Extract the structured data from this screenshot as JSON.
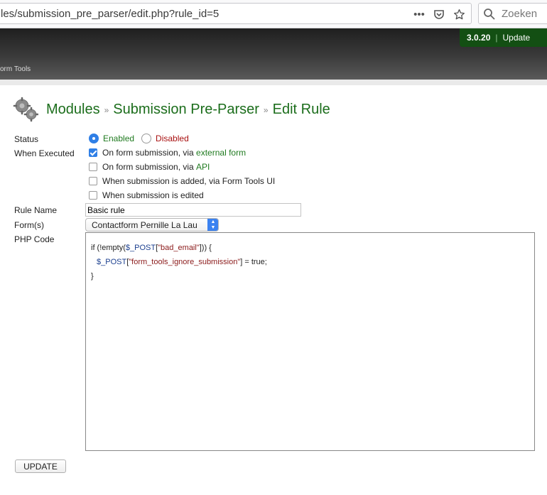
{
  "browser": {
    "url": "les/submission_pre_parser/edit.php?rule_id=5",
    "search_placeholder": "Zoeken",
    "icons": [
      "more-icon",
      "pocket-icon",
      "bookmark-star-icon",
      "search-icon"
    ]
  },
  "header": {
    "crumb": "orm Tools",
    "version": "3.0.20",
    "separator": "|",
    "update_label": "Update"
  },
  "title": {
    "modules": "Modules",
    "sep": "»",
    "module_name": "Submission Pre-Parser",
    "current": "Edit Rule"
  },
  "form": {
    "status_label": "Status",
    "status_options": [
      {
        "label": "Enabled",
        "checked": true
      },
      {
        "label": "Disabled",
        "checked": false
      }
    ],
    "when_label": "When Executed",
    "when_options": [
      {
        "prefix": "On form submission, via ",
        "link": "external form",
        "checked": true
      },
      {
        "prefix": "On form submission, via ",
        "link": "API",
        "checked": false
      },
      {
        "prefix": "When submission is added, via Form Tools UI",
        "link": "",
        "checked": false
      },
      {
        "prefix": "When submission is edited",
        "link": "",
        "checked": false
      }
    ],
    "rule_name_label": "Rule Name",
    "rule_name_value": "Basic rule",
    "forms_label": "Form(s)",
    "forms_selected": "Contactform Pernille La Lau",
    "php_label": "PHP Code",
    "code": {
      "line1_a": "if (!empty(",
      "line1_var": "$_POST",
      "line1_b": "[",
      "line1_str": "\"bad_email\"",
      "line1_c": "])) {",
      "line2_var": "$_POST",
      "line2_b": "[",
      "line2_str": "\"form_tools_ignore_submission\"",
      "line2_c": "] = true;",
      "line3": "}"
    },
    "submit_label": "UPDATE"
  },
  "colors": {
    "accent_green": "#1b6d1b",
    "version_bg": "#134f13",
    "checkbox_blue": "#2f7fe6",
    "disabled_red": "#a81010"
  }
}
